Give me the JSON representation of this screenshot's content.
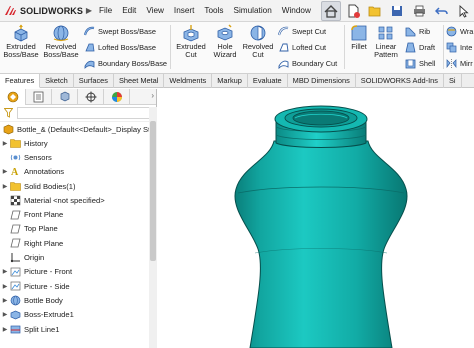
{
  "app": {
    "brand": "SOLIDWORKS",
    "accent_color": "#d7262d"
  },
  "menu": {
    "items": [
      "File",
      "Edit",
      "View",
      "Insert",
      "Tools",
      "Simulation",
      "Window"
    ],
    "pin_icon": "pushpin-icon"
  },
  "quick_access": [
    "home-icon",
    "new-document-icon",
    "open-folder-icon",
    "save-icon",
    "print-icon",
    "undo-icon",
    "select-arrow-icon"
  ],
  "ribbon": {
    "extruded_boss": "Extruded\nBoss/Base",
    "revolved_boss": "Revolved\nBoss/Base",
    "swept_boss": "Swept Boss/Base",
    "lofted_boss": "Lofted Boss/Base",
    "boundary_boss": "Boundary Boss/Base",
    "extruded_cut": "Extruded\nCut",
    "hole_wizard": "Hole\nWizard",
    "revolved_cut": "Revolved\nCut",
    "swept_cut": "Swept Cut",
    "lofted_cut": "Lofted Cut",
    "boundary_cut": "Boundary Cut",
    "fillet": "Fillet",
    "linear_pattern": "Linear\nPattern",
    "rib": "Rib",
    "draft": "Draft",
    "shell": "Shell",
    "wrap": "Wra",
    "intersect": "Inte",
    "mirror": "Mirr"
  },
  "tabs": [
    "Features",
    "Sketch",
    "Surfaces",
    "Sheet Metal",
    "Weldments",
    "Markup",
    "Evaluate",
    "MBD Dimensions",
    "SOLIDWORKS Add-Ins",
    "Si"
  ],
  "feature_tree": {
    "root": "Bottle_&  (Default<<Default>_Display St",
    "items": [
      {
        "label": "History",
        "icon": "history-folder-icon",
        "expand": true
      },
      {
        "label": "Sensors",
        "icon": "sensors-icon",
        "expand": false
      },
      {
        "label": "Annotations",
        "icon": "annotations-icon",
        "expand": true
      },
      {
        "label": "Solid Bodies(1)",
        "icon": "solid-bodies-folder-icon",
        "expand": true
      },
      {
        "label": "Material <not specified>",
        "icon": "material-icon",
        "expand": false
      },
      {
        "label": "Front Plane",
        "icon": "plane-icon",
        "expand": false
      },
      {
        "label": "Top Plane",
        "icon": "plane-icon",
        "expand": false
      },
      {
        "label": "Right Plane",
        "icon": "plane-icon",
        "expand": false
      },
      {
        "label": "Origin",
        "icon": "origin-icon",
        "expand": false
      },
      {
        "label": "Picture - Front",
        "icon": "sketch-picture-icon",
        "expand": true
      },
      {
        "label": "Picture - Side",
        "icon": "sketch-picture-icon",
        "expand": true
      },
      {
        "label": "Bottle Body",
        "icon": "revolve-feature-icon",
        "expand": true
      },
      {
        "label": "Boss-Extrude1",
        "icon": "extrude-feature-icon",
        "expand": true
      },
      {
        "label": "Split Line1",
        "icon": "split-line-icon",
        "expand": true
      }
    ]
  },
  "model": {
    "color": "#10b3ad"
  }
}
